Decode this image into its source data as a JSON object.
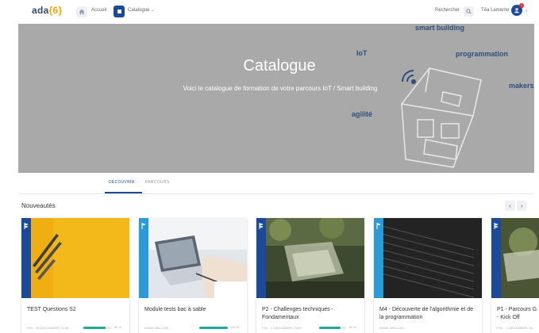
{
  "nav": {
    "logo_main": "ada",
    "logo_suffix": "{6}",
    "home_label": "Accueil",
    "catalogue_label": "Catalogue",
    "search_label": "Rechercher",
    "user_name": "Téa Lamente",
    "notification_count": "1"
  },
  "banner": {
    "title": "Catalogue",
    "subtitle": "Voici le catalogue de formation de votre parcours IoT / Smart building",
    "keywords": {
      "smart_building": "smart building",
      "iot": "IoT",
      "programmation": "programmation",
      "makers": "makers",
      "agilite": "agilité"
    }
  },
  "tabs": {
    "decouvrir": "DÉCOUVRIR",
    "parcours": "PARCOURS"
  },
  "section": {
    "title": "Nouveautés",
    "prev": "‹",
    "next": "›"
  },
  "colors": {
    "primary": "#1b4a9a",
    "accent_light": "#2a9bd8",
    "progress": "#22a89a",
    "banner_bg": "#a9a9a9",
    "keyword": "#2f4e7e"
  },
  "cards": [
    {
      "title": "TEST Questions S2",
      "meta": "FIN : 26 DÉCEMBRE 2020",
      "progress": 80,
      "progress_label": "80 %"
    },
    {
      "title": "Module tests bac à sable",
      "meta": "ANNE BELLON",
      "progress": 100,
      "progress_label": "100 %"
    },
    {
      "title": "P2 - Challenges techniques - Fondamentaux",
      "meta": "FIN : 1 DÉCEMBRE 2020",
      "progress": 80,
      "progress_label": "80 %"
    },
    {
      "title": "M4 - Découverte de l'algorithmie et de la programmation",
      "meta": "ANNE BELLON",
      "progress": null,
      "progress_label": ""
    },
    {
      "title": "P1 - Parcours G - Kick Off",
      "meta": "FIN : 1 DÉCEMBRE 20",
      "progress": null,
      "progress_label": ""
    }
  ]
}
